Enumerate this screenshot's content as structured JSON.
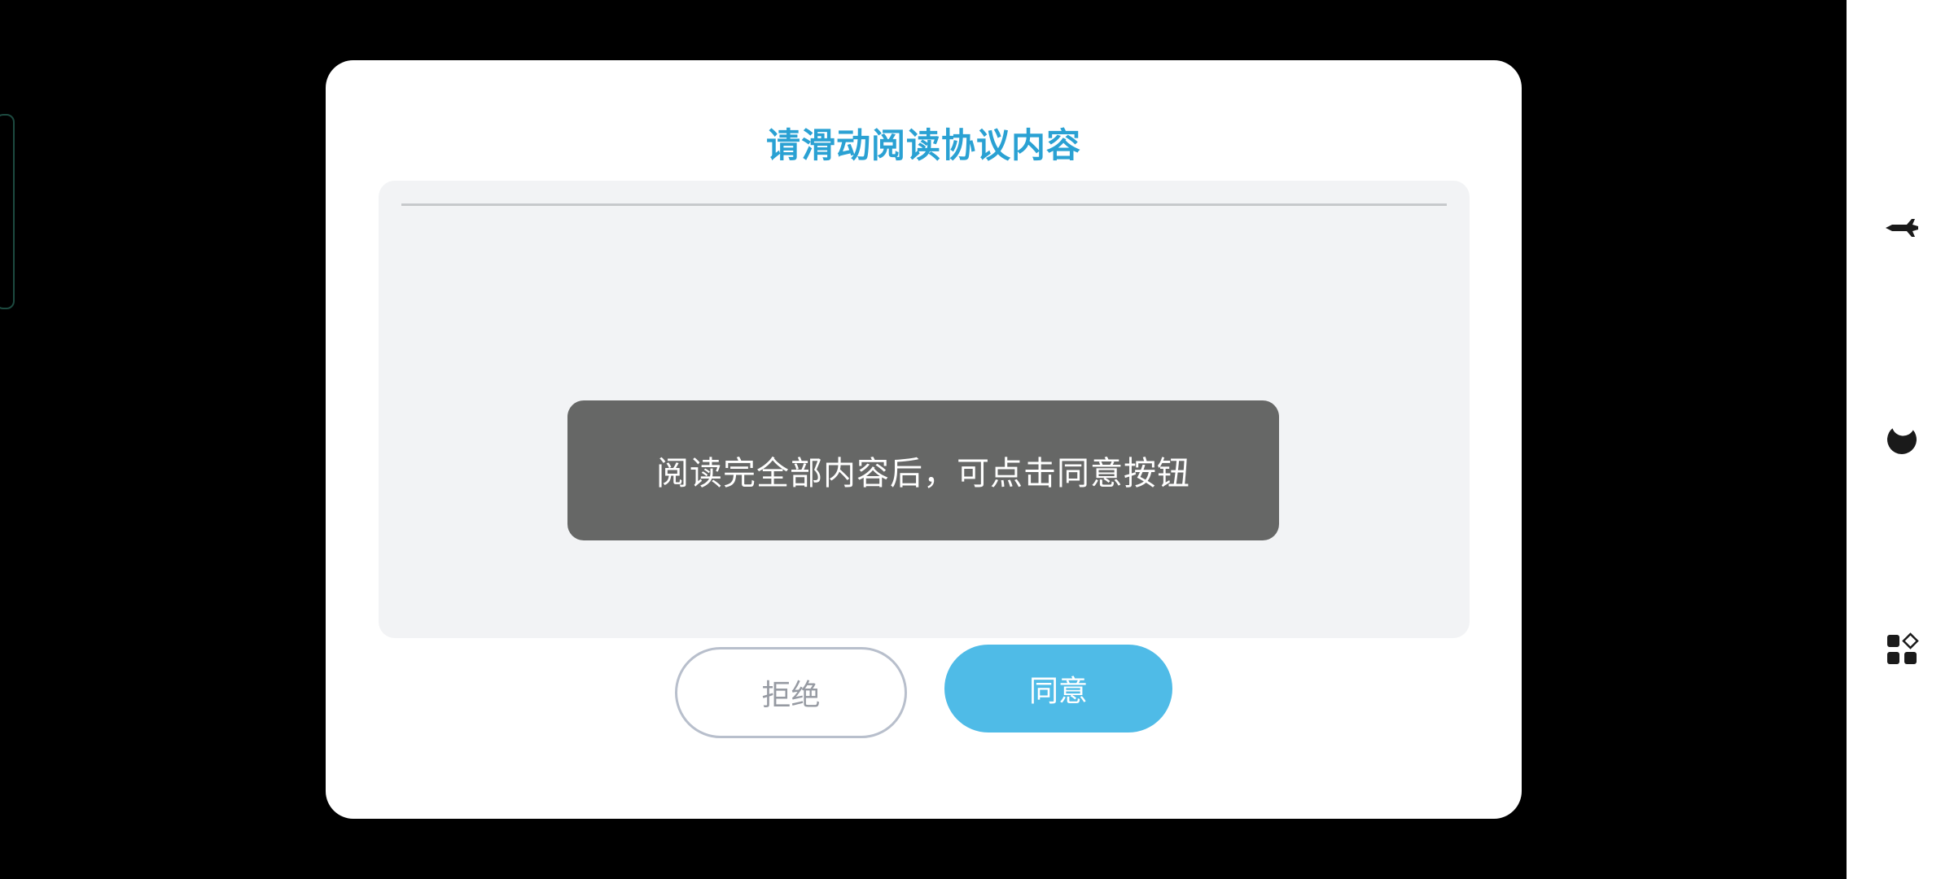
{
  "dialog": {
    "title": "请滑动阅读协议内容",
    "toast": "阅读完全部内容后，可点击同意按钮",
    "reject_label": "拒绝",
    "agree_label": "同意"
  },
  "side_bar": {
    "icons": [
      "airplane-icon",
      "moon-icon",
      "apps-icon"
    ]
  },
  "colors": {
    "title": "#2aa1d3",
    "agree_button": "#4fbbe7",
    "toast_bg": "#666766",
    "content_bg": "#f2f3f5"
  }
}
